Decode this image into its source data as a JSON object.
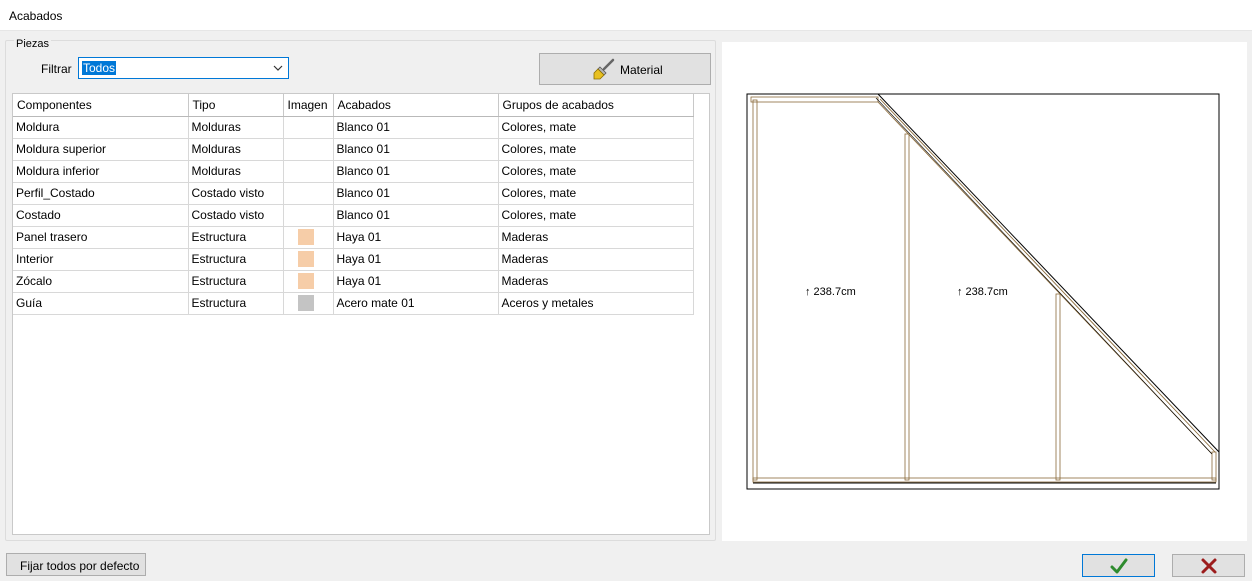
{
  "window": {
    "title": "Acabados"
  },
  "pieces": {
    "group_label": "Piezas",
    "filter_label": "Filtrar",
    "filter_value": "Todos",
    "material_button": "Material",
    "material_icon": "paintbrush-icon"
  },
  "table": {
    "headers": [
      "Componentes",
      "Tipo",
      "Imagen",
      "Acabados",
      "Grupos de acabados"
    ],
    "rows": [
      {
        "component": "Moldura",
        "type": "Molduras",
        "swatch": "",
        "finish": "Blanco 01",
        "group": "Colores, mate"
      },
      {
        "component": "Moldura superior",
        "type": "Molduras",
        "swatch": "",
        "finish": "Blanco 01",
        "group": "Colores, mate"
      },
      {
        "component": "Moldura inferior",
        "type": "Molduras",
        "swatch": "",
        "finish": "Blanco 01",
        "group": "Colores, mate"
      },
      {
        "component": "Perfil_Costado",
        "type": "Costado visto",
        "swatch": "",
        "finish": "Blanco 01",
        "group": "Colores, mate"
      },
      {
        "component": "Costado",
        "type": "Costado visto",
        "swatch": "",
        "finish": "Blanco 01",
        "group": "Colores, mate"
      },
      {
        "component": "Panel trasero",
        "type": "Estructura",
        "swatch": "#f6cda8",
        "finish": "Haya 01",
        "group": "Maderas"
      },
      {
        "component": "Interior",
        "type": "Estructura",
        "swatch": "#f6cda8",
        "finish": "Haya 01",
        "group": "Maderas"
      },
      {
        "component": "Zócalo",
        "type": "Estructura",
        "swatch": "#f6cda8",
        "finish": "Haya 01",
        "group": "Maderas"
      },
      {
        "component": "Guía",
        "type": "Estructura",
        "swatch": "#c4c4c4",
        "finish": "Acero mate 01",
        "group": "Aceros y metales"
      }
    ]
  },
  "preview": {
    "dim_left": "↑ 238.7cm",
    "dim_mid": "↑ 238.7cm",
    "wood_color": "#c9a070"
  },
  "buttons": {
    "default_label": "Fijar todos por defecto",
    "ok_icon": "checkmark-icon",
    "cancel_icon": "cross-icon",
    "ok_color": "#2e8b2e",
    "cancel_color": "#9c1c1c"
  }
}
